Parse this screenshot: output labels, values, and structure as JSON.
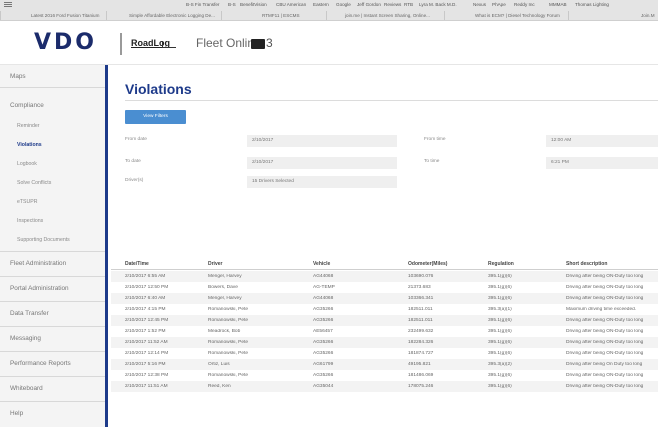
{
  "browser": {
    "bookmarks_row1": [
      "B-S Fin Transfer",
      "B-S",
      "BenefitVision",
      "CBU American",
      "Eastern",
      "Google",
      "Jeff Gordon",
      "Reviews",
      "RTB",
      "Lyra M. Back M.D.",
      "Nexus",
      "PhApe",
      "Reddy Inc",
      "MMMAB",
      "Thomas Lighting"
    ],
    "tabs_row2": [
      "Latest 2016 Ford Fusion Titanium",
      "Simple Affordable Electronic Logging De...",
      "RTMF11 | ESCMS",
      "join.me | Instant Screen Sharing, Online...",
      "What is ECM? | Diesel Technology Forum",
      "Join.M"
    ]
  },
  "header": {
    "logo": "VDO",
    "product": "RoadLog",
    "app_name": "Fleet Online",
    "message_count": "3"
  },
  "sidebar": {
    "maps": "Maps",
    "compliance": "Compliance",
    "sub_items": [
      "Reminder",
      "Violations",
      "Logbook",
      "Solve Conflicts",
      "eTSUPR",
      "Inspections",
      "Supporting Documents"
    ],
    "active_sub_index": 1,
    "sections": [
      "Fleet Administration",
      "Portal Administration",
      "Data Transfer",
      "Messaging",
      "Performance Reports",
      "Whiteboard",
      "Help"
    ]
  },
  "main": {
    "title": "Violations",
    "primary_button": "View Filters",
    "filters": {
      "from_date_label": "From date",
      "from_date_value": "2/10/2017",
      "from_time_label": "From time",
      "from_time_value": "12:00 AM",
      "to_date_label": "To date",
      "to_date_value": "2/10/2017",
      "to_time_label": "To time",
      "to_time_value": "6:21 PM",
      "drivers_label": "Driver(s)",
      "drivers_value": "15 Drivers Selected"
    },
    "table": {
      "columns": [
        "Date/Time",
        "Driver",
        "Vehicle",
        "Odometer(Miles)",
        "Regulation",
        "Short description"
      ],
      "rows": [
        [
          "2/10/2017 6:55 AM",
          "Mengel, Harvey",
          "AG44068",
          "103690.076",
          "395.1(g)(6)",
          "Driving after being ON-Duty too long"
        ],
        [
          "2/10/2017 12:50 PM",
          "Bowers, Dave",
          "AG-TEMP",
          "21373.683",
          "395.1(g)(6)",
          "Driving after being ON-Duty too long"
        ],
        [
          "2/10/2017 6:40 AM",
          "Mengel, Harvey",
          "AG44068",
          "103366.341",
          "395.1(g)(6)",
          "Driving after being ON-Duty too long"
        ],
        [
          "2/10/2017 4:15 PM",
          "Romanowski, Pete",
          "AG35266",
          "182511.011",
          "395.3(a)(1)",
          "Maximum driving time exceeded."
        ],
        [
          "2/10/2017 12:45 PM",
          "Romanowski, Pete",
          "AG35266",
          "182511.011",
          "395.1(g)(6)",
          "Driving after being ON-Duty too long"
        ],
        [
          "2/10/2017 1:52 PM",
          "Meadrock, Bob",
          "AE56457",
          "232499.632",
          "395.1(g)(6)",
          "Driving after being ON-Duty too long"
        ],
        [
          "2/10/2017 11:52 AM",
          "Romanowski, Pete",
          "AG35266",
          "182284.326",
          "395.1(g)(6)",
          "Driving after being ON-Duty too long"
        ],
        [
          "2/10/2017 12:14 PM",
          "Romanowski, Pete",
          "AG35266",
          "181874.727",
          "395.1(g)(6)",
          "Driving after being ON-Duty too long"
        ],
        [
          "2/10/2017 5:16 PM",
          "Ortiz, Luis",
          "AG61799",
          "49195.821",
          "395.3(a)(2)",
          "Driving after being On Duty too long"
        ],
        [
          "2/10/2017 12:38 PM",
          "Romanowski, Pete",
          "AG35266",
          "181486.069",
          "395.1(g)(6)",
          "Driving after being ON-Duty too long"
        ],
        [
          "2/10/2017 11:51 AM",
          "Reed, Ken",
          "AG35044",
          "178075.246",
          "395.1(g)(6)",
          "Driving after being ON-Duty too long"
        ]
      ]
    }
  }
}
